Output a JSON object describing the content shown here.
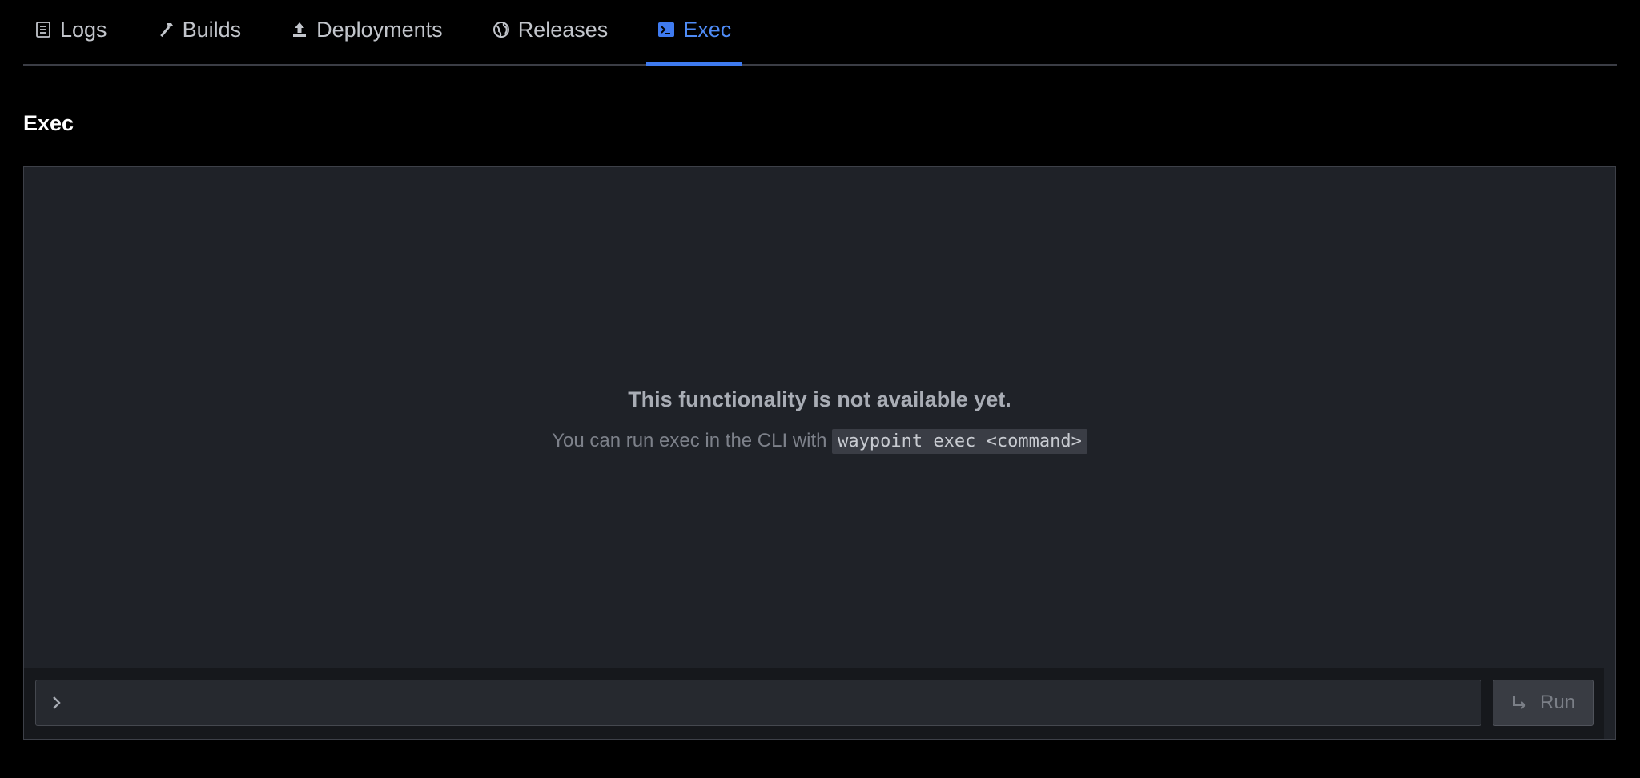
{
  "tabs": [
    {
      "label": "Logs",
      "icon": "logs-icon",
      "active": false
    },
    {
      "label": "Builds",
      "icon": "hammer-icon",
      "active": false
    },
    {
      "label": "Deployments",
      "icon": "upload-icon",
      "active": false
    },
    {
      "label": "Releases",
      "icon": "globe-icon",
      "active": false
    },
    {
      "label": "Exec",
      "icon": "terminal-icon",
      "active": true
    }
  ],
  "section": {
    "title": "Exec"
  },
  "empty_state": {
    "title": "This functionality is not available yet.",
    "description": "You can run exec in the CLI with",
    "command": "waypoint exec <command>"
  },
  "command_bar": {
    "input_value": "",
    "run_label": "Run",
    "run_icon": "enter-arrow-icon",
    "prompt_icon": "chevron-right-icon"
  },
  "colors": {
    "accent": "#4f8cf7",
    "background": "#000000",
    "panel": "#1f2228"
  }
}
